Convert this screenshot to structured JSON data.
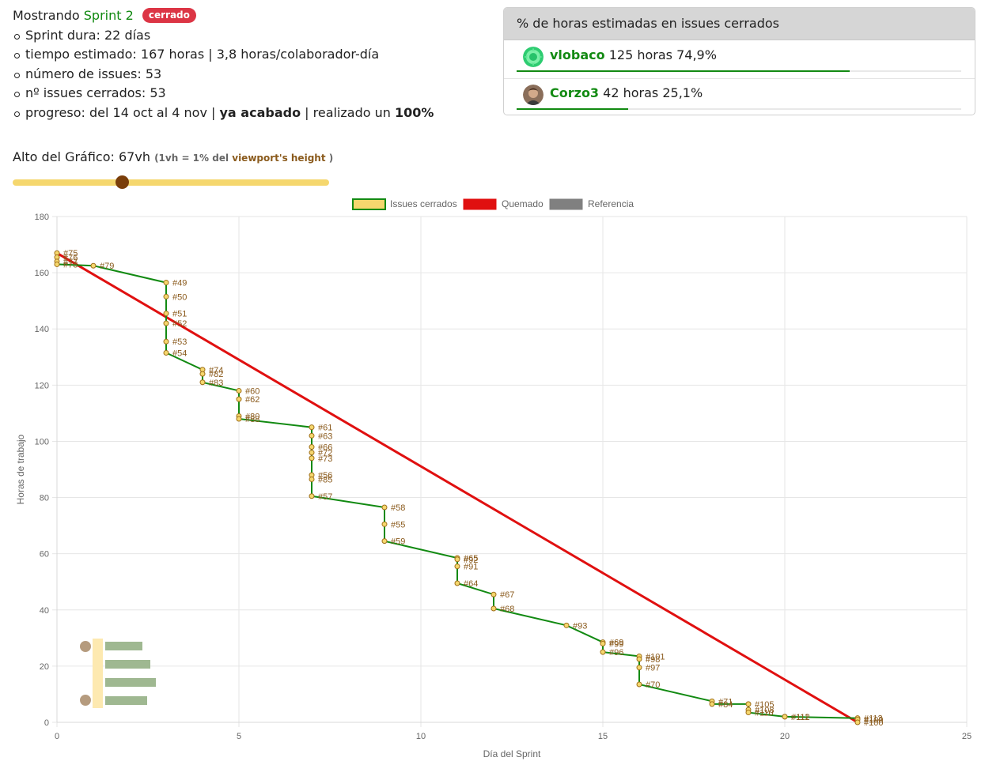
{
  "summary": {
    "showing_label": "Mostrando",
    "sprint_name": "Sprint 2",
    "status_badge": "cerrado",
    "items": [
      "Sprint dura: 22 días",
      "tiempo estimado: 167 horas | 3,8 horas/colaborador-día",
      "número de issues: 53",
      "nº issues cerrados: 53"
    ],
    "progress": {
      "prefix": "progreso: del 14 oct al 4 nov | ",
      "finished": "ya acabado",
      "middle": " | realizado un ",
      "percent": "100%"
    }
  },
  "height_control": {
    "label": "Alto del Gráfico: 67vh",
    "hint_prefix": "(1vh = 1% del ",
    "hint_viewport": "viewport's height",
    "hint_suffix": " )",
    "value_vh": 67
  },
  "estimate_panel": {
    "title": "% de horas estimadas en issues cerrados",
    "collaborators": [
      {
        "name": "vlobaco",
        "stats": "125 horas 74,9%",
        "share": 0.749,
        "avatar": "green-identicon-avatar"
      },
      {
        "name": "Corzo3",
        "stats": "42 horas 25,1%",
        "share": 0.251,
        "avatar": "photo-avatar"
      }
    ]
  },
  "colors": {
    "accent_green": "#128a12",
    "burn_red": "#e01010",
    "reference_gray": "#808080",
    "point_fill": "#f5d76e",
    "badge_red": "#dc3545"
  },
  "chart_data": {
    "type": "line",
    "title": "",
    "xlabel": "Día del Sprint",
    "ylabel": "Horas de trabajo",
    "xlim": [
      0,
      25
    ],
    "ylim": [
      0,
      180
    ],
    "x_ticks": [
      0,
      5,
      10,
      15,
      20,
      25
    ],
    "y_ticks": [
      0,
      20,
      40,
      60,
      80,
      100,
      120,
      140,
      160,
      180
    ],
    "grid": true,
    "legend_position": "top",
    "legend": [
      "Issues cerrados",
      "Quemado",
      "Referencia"
    ],
    "series": [
      {
        "name": "Issues cerrados",
        "points": [
          {
            "x": 0,
            "y": 167,
            "label": "#75"
          },
          {
            "x": 0,
            "y": 165.5,
            "label": "#76"
          },
          {
            "x": 0,
            "y": 164,
            "label": "#77"
          },
          {
            "x": 0,
            "y": 163,
            "label": "#78"
          },
          {
            "x": 1,
            "y": 162.5,
            "label": "#79"
          },
          {
            "x": 3,
            "y": 156.5,
            "label": "#49"
          },
          {
            "x": 3,
            "y": 151.5,
            "label": "#50"
          },
          {
            "x": 3,
            "y": 145.5,
            "label": "#51"
          },
          {
            "x": 3,
            "y": 142,
            "label": "#52"
          },
          {
            "x": 3,
            "y": 135.5,
            "label": "#53"
          },
          {
            "x": 3,
            "y": 131.5,
            "label": "#54"
          },
          {
            "x": 4,
            "y": 125.5,
            "label": "#74"
          },
          {
            "x": 4,
            "y": 124,
            "label": "#82"
          },
          {
            "x": 4,
            "y": 121,
            "label": "#83"
          },
          {
            "x": 5,
            "y": 118,
            "label": "#60"
          },
          {
            "x": 5,
            "y": 115,
            "label": "#62"
          },
          {
            "x": 5,
            "y": 109,
            "label": "#80"
          },
          {
            "x": 5,
            "y": 108,
            "label": "#88"
          },
          {
            "x": 7,
            "y": 105,
            "label": "#61"
          },
          {
            "x": 7,
            "y": 102,
            "label": "#63"
          },
          {
            "x": 7,
            "y": 98,
            "label": "#66"
          },
          {
            "x": 7,
            "y": 96,
            "label": "#72"
          },
          {
            "x": 7,
            "y": 94,
            "label": "#73"
          },
          {
            "x": 7,
            "y": 88,
            "label": "#56"
          },
          {
            "x": 7,
            "y": 86.5,
            "label": "#85"
          },
          {
            "x": 7,
            "y": 80.5,
            "label": "#57"
          },
          {
            "x": 9,
            "y": 76.5,
            "label": "#58"
          },
          {
            "x": 9,
            "y": 70.5,
            "label": "#55"
          },
          {
            "x": 9,
            "y": 64.5,
            "label": "#59"
          },
          {
            "x": 11,
            "y": 58.5,
            "label": "#65"
          },
          {
            "x": 11,
            "y": 58,
            "label": "#92"
          },
          {
            "x": 11,
            "y": 55.5,
            "label": "#91"
          },
          {
            "x": 11,
            "y": 49.5,
            "label": "#64"
          },
          {
            "x": 12,
            "y": 45.5,
            "label": "#67"
          },
          {
            "x": 12,
            "y": 40.5,
            "label": "#68"
          },
          {
            "x": 14,
            "y": 34.5,
            "label": "#93"
          },
          {
            "x": 15,
            "y": 28.5,
            "label": "#69"
          },
          {
            "x": 15,
            "y": 28,
            "label": "#99"
          },
          {
            "x": 15,
            "y": 25,
            "label": "#96"
          },
          {
            "x": 16,
            "y": 23.5,
            "label": "#101"
          },
          {
            "x": 16,
            "y": 22.5,
            "label": "#98"
          },
          {
            "x": 16,
            "y": 19.5,
            "label": "#97"
          },
          {
            "x": 16,
            "y": 13.5,
            "label": "#70"
          },
          {
            "x": 18,
            "y": 7.5,
            "label": "#71"
          },
          {
            "x": 18,
            "y": 6.5,
            "label": "#84"
          },
          {
            "x": 19,
            "y": 6.5,
            "label": "#105"
          },
          {
            "x": 19,
            "y": 4.5,
            "label": "#108"
          },
          {
            "x": 19,
            "y": 3.5,
            "label": "#110"
          },
          {
            "x": 20,
            "y": 2,
            "label": "#111"
          },
          {
            "x": 20,
            "y": 2,
            "label": "#112"
          },
          {
            "x": 22,
            "y": 1.5,
            "label": "#113"
          },
          {
            "x": 22,
            "y": 1,
            "label": "#109"
          },
          {
            "x": 22,
            "y": 0,
            "label": "#100"
          }
        ]
      },
      {
        "name": "Quemado",
        "points": [
          {
            "x": 0,
            "y": 167
          },
          {
            "x": 22,
            "y": 0
          }
        ]
      },
      {
        "name": "Referencia",
        "points": []
      }
    ]
  }
}
